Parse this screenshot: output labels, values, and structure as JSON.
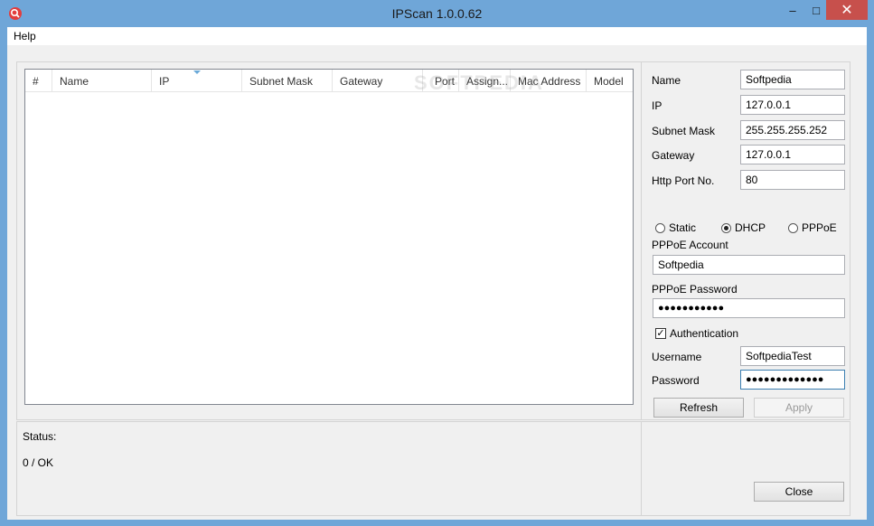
{
  "window": {
    "title": "IPScan 1.0.0.62",
    "minimize": "–",
    "maximize": "□",
    "close": "✕"
  },
  "menu": {
    "help": "Help"
  },
  "list": {
    "columns": [
      "#",
      "Name",
      "IP",
      "Subnet Mask",
      "Gateway",
      "Port",
      "Assign...",
      "Mac Address",
      "Model"
    ],
    "watermark": "SOFTPEDIA"
  },
  "settings": {
    "name_label": "Name",
    "name_value": "Softpedia",
    "ip_label": "IP",
    "ip_value": "127.0.0.1",
    "subnet_label": "Subnet Mask",
    "subnet_value": "255.255.255.252",
    "gateway_label": "Gateway",
    "gateway_value": "127.0.0.1",
    "port_label": "Http Port No.",
    "port_value": "80",
    "mode_options": [
      {
        "label": "Static",
        "selected": false
      },
      {
        "label": "DHCP",
        "selected": true
      },
      {
        "label": "PPPoE",
        "selected": false
      }
    ],
    "pppoe_account_label": "PPPoE Account",
    "pppoe_account_value": "Softpedia",
    "pppoe_password_label": "PPPoE Password",
    "pppoe_password_value": "●●●●●●●●●●●",
    "auth_label": "Authentication",
    "auth_checked": true,
    "auth_mark": "✓",
    "username_label": "Username",
    "username_value": "SoftpediaTest",
    "password_label": "Password",
    "password_value": "●●●●●●●●●●●●●",
    "refresh_label": "Refresh",
    "apply_label": "Apply"
  },
  "status": {
    "label": "Status:",
    "value": "0 / OK"
  },
  "close_label": "Close"
}
